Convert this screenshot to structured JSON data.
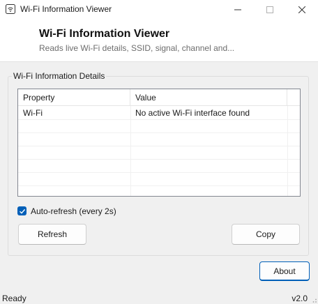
{
  "window": {
    "title": "Wi-Fi Information Viewer",
    "icon": "wifi-app-icon"
  },
  "header": {
    "title": "Wi-Fi Information Viewer",
    "subtitle": "Reads live Wi-Fi details, SSID, signal, channel and..."
  },
  "details": {
    "group_label": "Wi-Fi Information Details",
    "columns": [
      "Property",
      "Value"
    ],
    "rows": [
      {
        "property": "Wi-Fi",
        "value": "No active Wi-Fi interface found"
      }
    ]
  },
  "auto_refresh": {
    "label": "Auto-refresh (every 2s)",
    "checked": true
  },
  "buttons": {
    "refresh": "Refresh",
    "copy": "Copy",
    "about": "About"
  },
  "status": {
    "text": "Ready",
    "version": "v2.0"
  },
  "colors": {
    "accent": "#005fb8",
    "background": "#f0f0f0",
    "header_bg": "#ffffff"
  }
}
